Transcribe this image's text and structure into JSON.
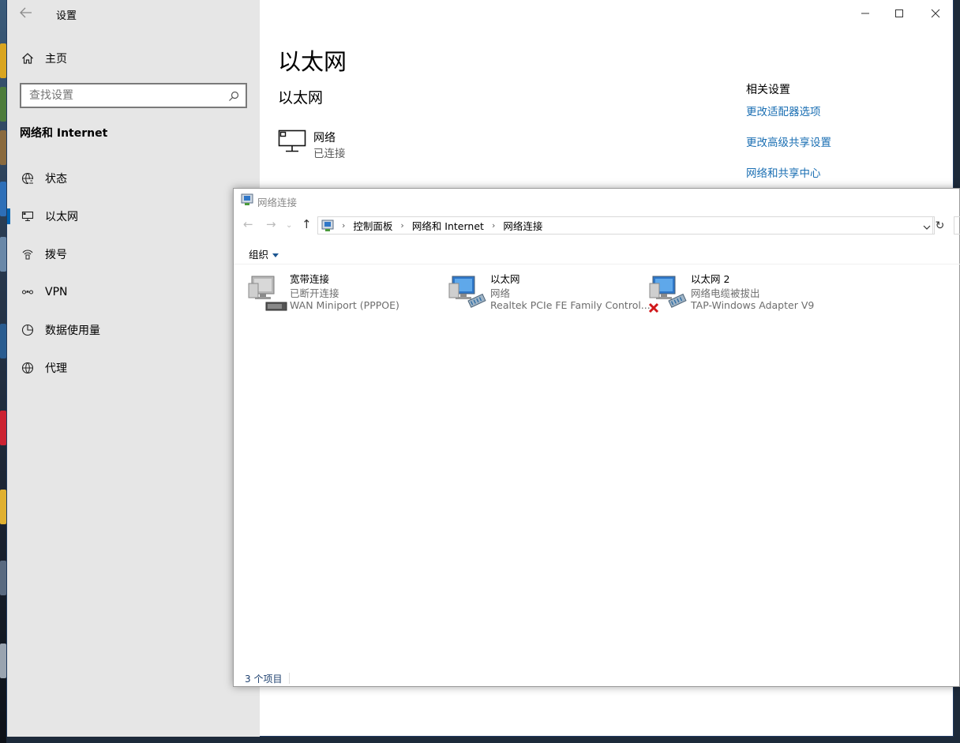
{
  "settings": {
    "app_title": "设置",
    "home_label": "主页",
    "search_placeholder": "查找设置",
    "section_title": "网络和 Internet",
    "nav_items": [
      {
        "label": "状态",
        "icon": "status-globe-icon"
      },
      {
        "label": "以太网",
        "icon": "ethernet-monitor-icon"
      },
      {
        "label": "拨号",
        "icon": "dialup-icon"
      },
      {
        "label": "VPN",
        "icon": "vpn-icon"
      },
      {
        "label": "数据使用量",
        "icon": "data-usage-icon"
      },
      {
        "label": "代理",
        "icon": "proxy-globe-icon"
      }
    ],
    "selected_nav": "以太网",
    "page_title": "以太网",
    "subheading": "以太网",
    "network": {
      "name": "网络",
      "status": "已连接"
    },
    "related": {
      "title": "相关设置",
      "links": [
        "更改适配器选项",
        "更改高级共享设置",
        "网络和共享中心"
      ]
    },
    "accent_link_color": "#1b6fb3",
    "selection_color": "#0063b1"
  },
  "explorer": {
    "title": "网络连接",
    "breadcrumb": [
      "控制面板",
      "网络和 Internet",
      "网络连接"
    ],
    "organize_label": "组织",
    "items": [
      {
        "name": "宽带连接",
        "status": "已断开连接",
        "device": "WAN Miniport (PPPOE)",
        "icon": "broadband-connection-icon"
      },
      {
        "name": "以太网",
        "status": "网络",
        "device": "Realtek PCIe FE Family Control...",
        "icon": "ethernet-adapter-icon"
      },
      {
        "name": "以太网 2",
        "status": "网络电缆被拔出",
        "device": "TAP-Windows Adapter V9",
        "icon": "ethernet-adapter-unplugged-icon"
      }
    ],
    "status_bar": "3 个项目"
  }
}
